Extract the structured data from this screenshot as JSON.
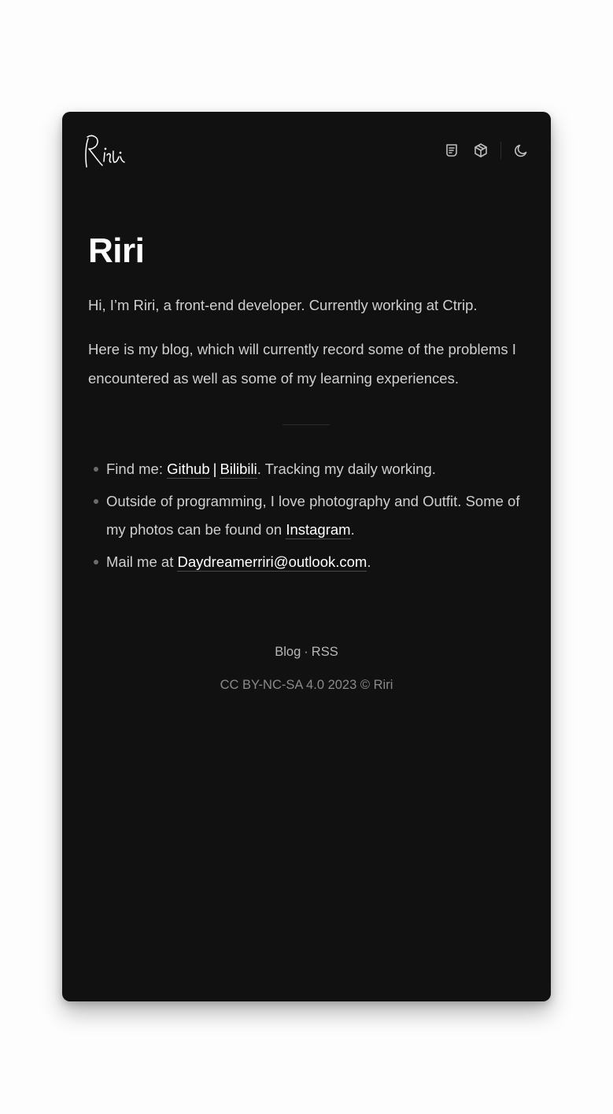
{
  "header": {
    "logo_text": "Riri",
    "icons": [
      "blog-icon",
      "projects-icon",
      "dark-mode-icon"
    ]
  },
  "main": {
    "title": "Riri",
    "intro": "Hi, I’m Riri, a front-end developer. Currently working at Ctrip.",
    "blog_text": "Here is my blog, which will currently record some of the problems I encountered as well as some of my learning experiences.",
    "list": {
      "find_prefix": "Find me: ",
      "github_label": "Github",
      "separator": "|",
      "bilibili_label": "Bilibili",
      "find_suffix": ". Tracking my daily working.",
      "outside_prefix": "Outside of programming, I love photography and Outfit. Some of my photos can be found on ",
      "instagram_label": "Instagram",
      "outside_suffix": ".",
      "mail_prefix": "Mail me at ",
      "email": "Daydreamerriri@outlook.com",
      "mail_suffix": "."
    }
  },
  "footer": {
    "blog_label": "Blog",
    "dot": "·",
    "rss_label": "RSS",
    "copyright": "CC BY-NC-SA 4.0 2023 © Riri"
  },
  "colors": {
    "page_background": "#fdfdfd",
    "window_background": "#111111",
    "heading": "#ffffff",
    "body_text": "#cfcfcf",
    "muted_text": "#8a8a8a"
  }
}
